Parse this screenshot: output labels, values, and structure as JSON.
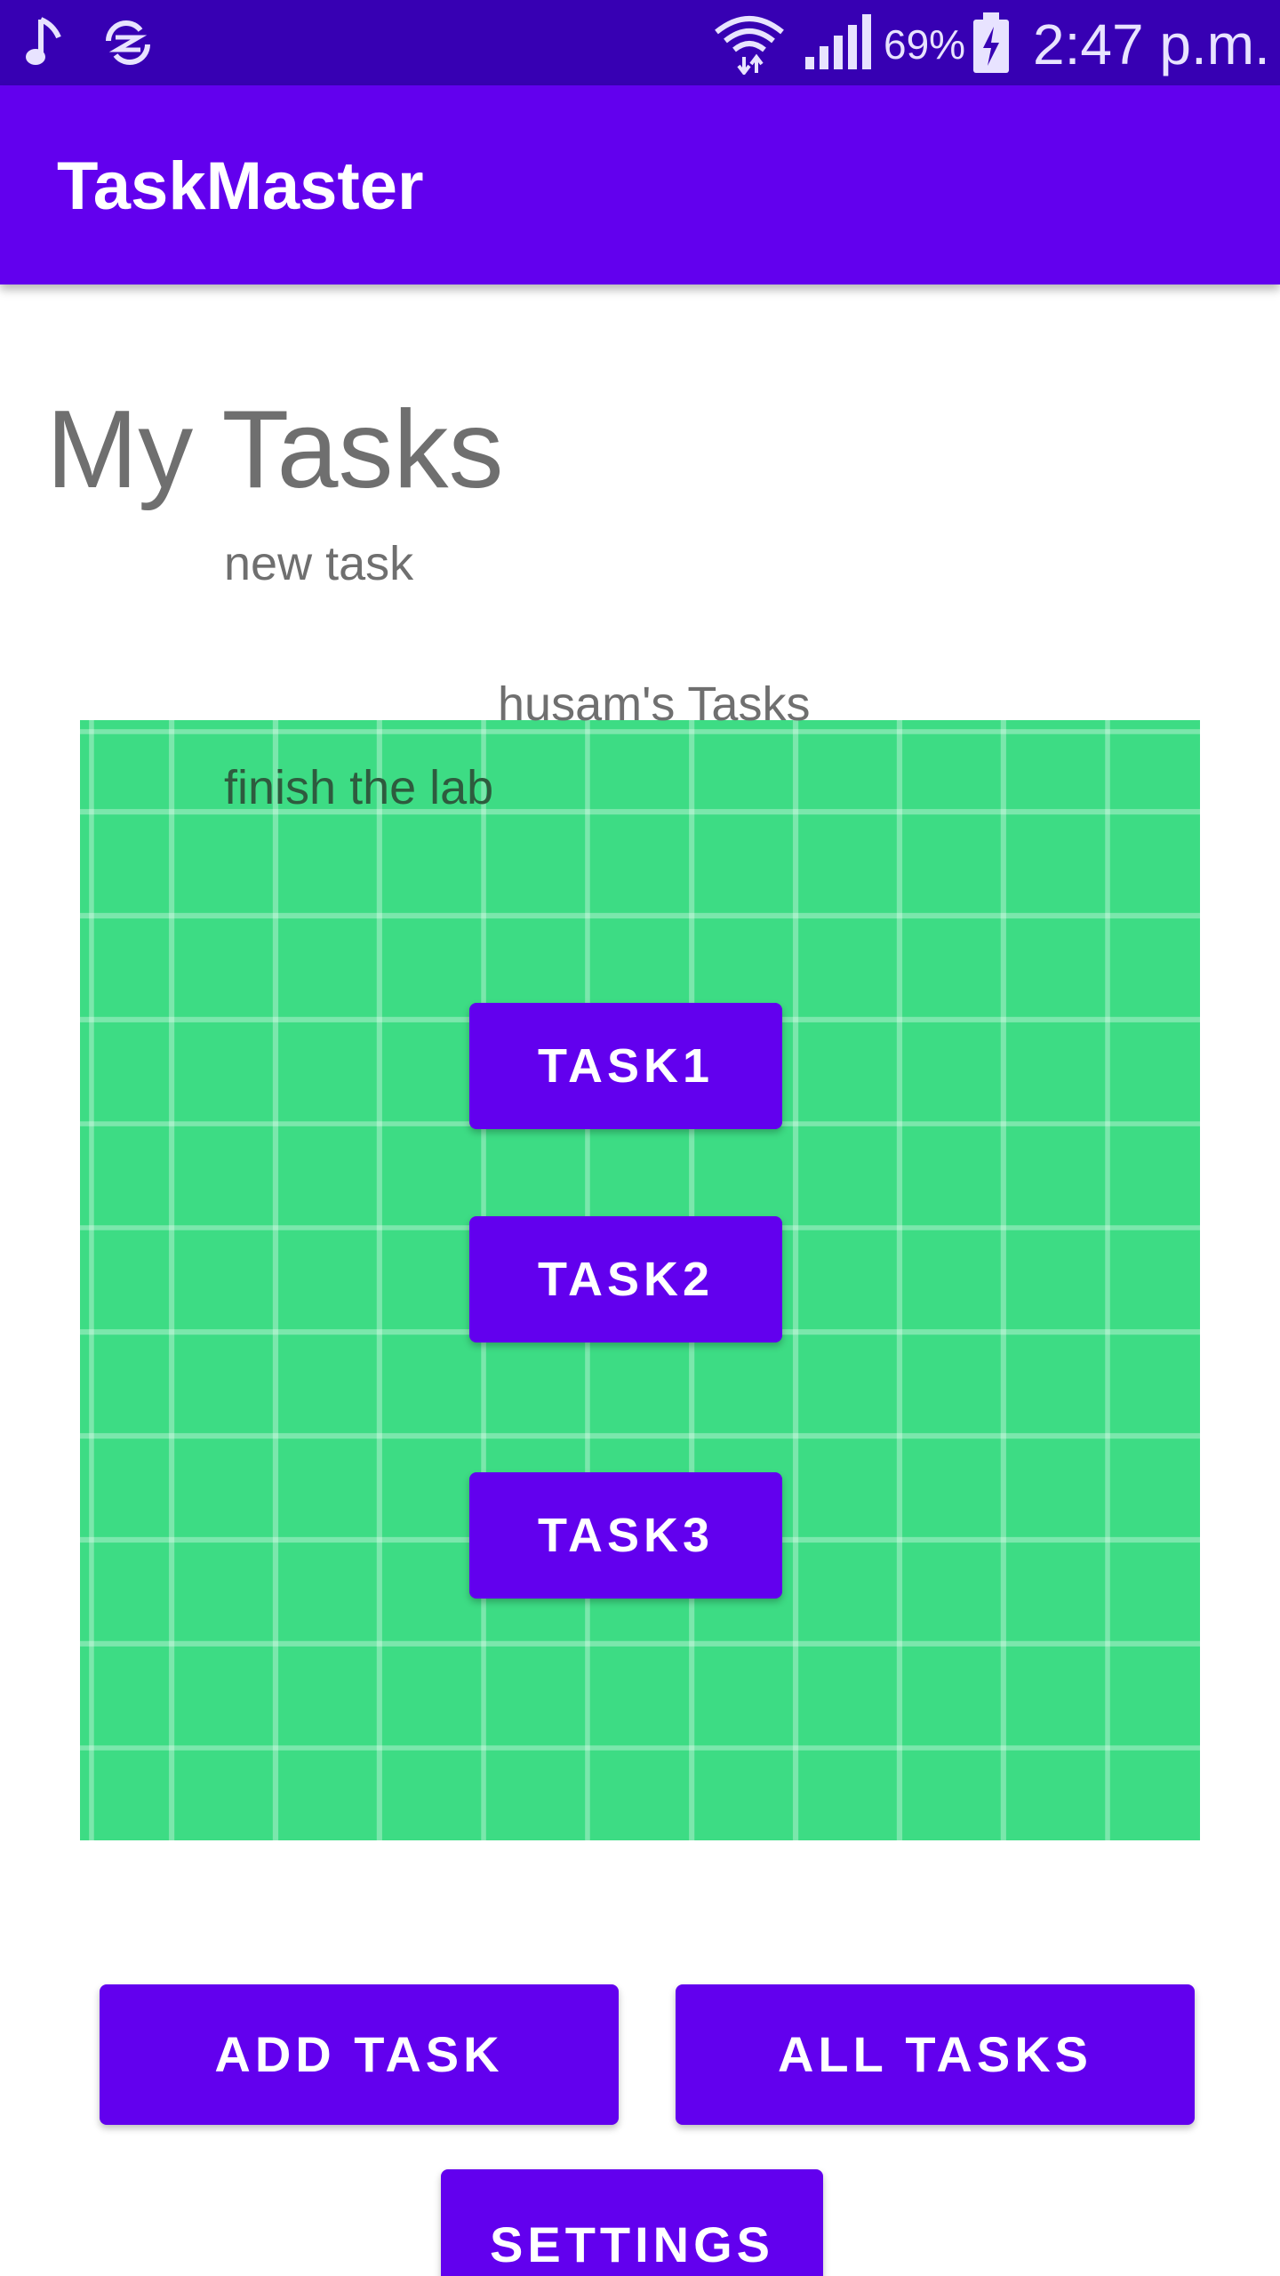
{
  "status_bar": {
    "battery_percent": "69%",
    "time": "2:47 p.m.",
    "icons": [
      "music-note-icon",
      "sync-icon",
      "wifi-icon",
      "cell-signal-icon",
      "battery-charging-icon"
    ]
  },
  "app_bar": {
    "title": "TaskMaster"
  },
  "main": {
    "page_title": "My Tasks",
    "new_task_label": "new task",
    "user_tasks_label": "husam's Tasks",
    "finish_lab_label": "finish the lab",
    "task_buttons": [
      "TASK1",
      "TASK2",
      "TASK3"
    ]
  },
  "actions": {
    "add_task": "ADD TASK",
    "all_tasks": "ALL TASKS",
    "settings": "SETTINGS"
  },
  "colors": {
    "status_bar": "#3700b3",
    "primary": "#6200ee",
    "grid_background": "#3ddc84",
    "text_gray": "#6f6f6f"
  }
}
